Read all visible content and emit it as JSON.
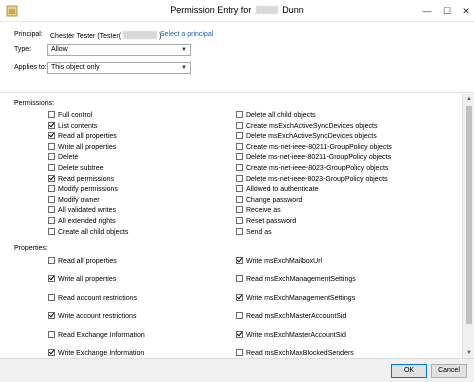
{
  "window": {
    "title_prefix": "Permission Entry for",
    "title_suffix": "Dunn",
    "min_glyph": "—",
    "max_glyph": "☐",
    "close_glyph": "✕"
  },
  "principal": {
    "label": "Principal:",
    "value": "Chester Tester (Tester(",
    "value_close": ")",
    "link": "Select a principal"
  },
  "type": {
    "label": "Type:",
    "value": "Allow"
  },
  "applies_to": {
    "label": "Applies to:",
    "value": "This object only"
  },
  "permissions": {
    "label": "Permissions:",
    "left": [
      {
        "label": "Full control",
        "checked": false
      },
      {
        "label": "List contents",
        "checked": true
      },
      {
        "label": "Read all properties",
        "checked": true
      },
      {
        "label": "Write all properties",
        "checked": false
      },
      {
        "label": "Delete",
        "checked": false
      },
      {
        "label": "Delete subtree",
        "checked": false
      },
      {
        "label": "Read permissions",
        "checked": true
      },
      {
        "label": "Modify permissions",
        "checked": false
      },
      {
        "label": "Modify owner",
        "checked": false
      },
      {
        "label": "All validated writes",
        "checked": false
      },
      {
        "label": "All extended rights",
        "checked": false
      },
      {
        "label": "Create all child objects",
        "checked": false
      }
    ],
    "right": [
      {
        "label": "Delete all child objects",
        "checked": false
      },
      {
        "label": "Create msExchActiveSyncDevices objects",
        "checked": false
      },
      {
        "label": "Delete msExchActiveSyncDevices objects",
        "checked": false
      },
      {
        "label": "Create ms-net-ieee-80211-GroupPolicy objects",
        "checked": false
      },
      {
        "label": "Delete ms-net-ieee-80211-GroupPolicy objects",
        "checked": false
      },
      {
        "label": "Create ms-net-ieee-8023-GroupPolicy objects",
        "checked": false
      },
      {
        "label": "Delete ms-net-ieee-8023-GroupPolicy objects",
        "checked": false
      },
      {
        "label": "Allowed to authenticate",
        "checked": false
      },
      {
        "label": "Change password",
        "checked": false
      },
      {
        "label": "Receive as",
        "checked": false
      },
      {
        "label": "Reset password",
        "checked": false
      },
      {
        "label": "Send as",
        "checked": false
      }
    ]
  },
  "properties": {
    "label": "Properties:",
    "left": [
      {
        "label": "Read all properties",
        "checked": false
      },
      {
        "label": "Write all properties",
        "checked": true
      },
      {
        "label": "Read account restrictions",
        "checked": false
      },
      {
        "label": "Write account restrictions",
        "checked": true
      },
      {
        "label": "Read Exchange Information",
        "checked": false
      },
      {
        "label": "Write Exchange Information",
        "checked": true
      }
    ],
    "right": [
      {
        "label": "Write msExchMailboxUrl",
        "checked": true
      },
      {
        "label": "Read msExchManagementSettings",
        "checked": false
      },
      {
        "label": "Write msExchManagementSettings",
        "checked": true
      },
      {
        "label": "Read msExchMasterAccountSid",
        "checked": false
      },
      {
        "label": "Write msExchMasterAccountSid",
        "checked": true
      },
      {
        "label": "Read msExchMaxBlockedSenders",
        "checked": false
      }
    ]
  },
  "scrollbar": {
    "up_glyph": "▲",
    "down_glyph": "▼"
  },
  "buttons": {
    "ok": "OK",
    "cancel": "Cancel"
  }
}
